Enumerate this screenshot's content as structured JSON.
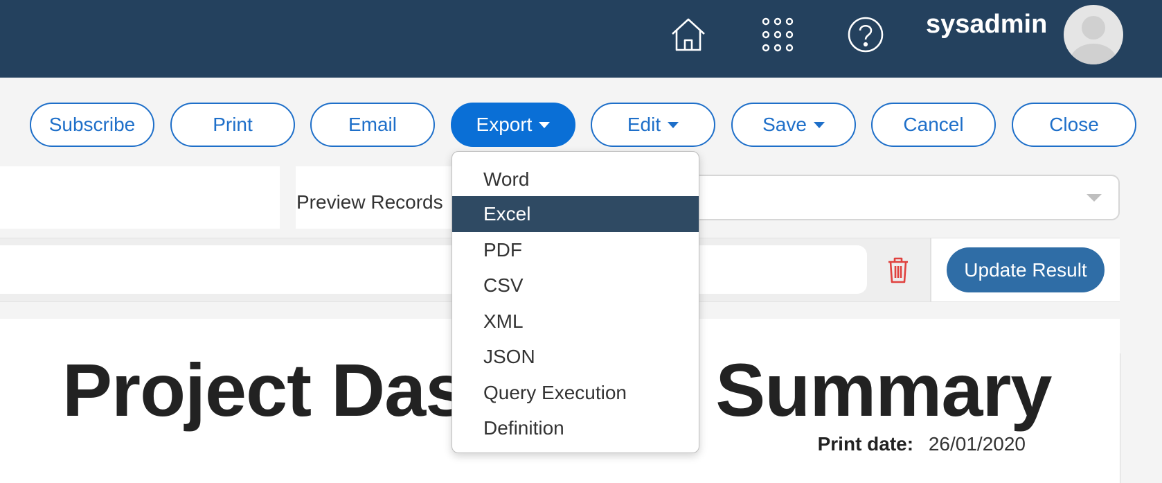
{
  "header": {
    "username": "sysadmin",
    "icons": [
      "home-icon",
      "apps-grid-icon",
      "help-icon",
      "user-avatar"
    ]
  },
  "toolbar": {
    "buttons": [
      {
        "label": "Subscribe",
        "has_caret": false,
        "active": false
      },
      {
        "label": "Print",
        "has_caret": false,
        "active": false
      },
      {
        "label": "Email",
        "has_caret": false,
        "active": false
      },
      {
        "label": "Export",
        "has_caret": true,
        "active": true
      },
      {
        "label": "Edit",
        "has_caret": true,
        "active": false
      },
      {
        "label": "Save",
        "has_caret": true,
        "active": false
      },
      {
        "label": "Cancel",
        "has_caret": false,
        "active": false
      },
      {
        "label": "Close",
        "has_caret": false,
        "active": false
      }
    ]
  },
  "export_menu": {
    "items": [
      "Word",
      "Excel",
      "PDF",
      "CSV",
      "XML",
      "JSON",
      "Query Execution",
      "Definition"
    ],
    "selected": "Excel"
  },
  "filters": {
    "preview_label": "Preview Records",
    "preview_value": "",
    "update_button": "Update Result"
  },
  "report": {
    "title_visible_left": "Project Das",
    "title_visible_right": "Summary",
    "print_date_label": "Print date:",
    "print_date_value": "26/01/2020"
  },
  "colors": {
    "header_bg": "#24415e",
    "accent": "#1e6fc9",
    "active_button": "#0a6fd6",
    "menu_selected": "#2f4a63",
    "update_button": "#2f6da6",
    "delete_icon": "#e0413e"
  }
}
